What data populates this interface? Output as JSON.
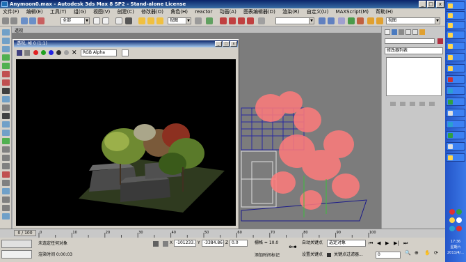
{
  "window": {
    "title": "Anymoon0.max - Autodesk 3ds Max 8 SP2 - Stand-alone License",
    "min_label": "_",
    "max_label": "□",
    "close_label": "x"
  },
  "menu": [
    "文件(F)",
    "编辑(E)",
    "工具(T)",
    "组(G)",
    "视图(V)",
    "创建(C)",
    "修改器(O)",
    "角色(H)",
    "reactor",
    "动画(A)",
    "图表编辑器(D)",
    "渲染(R)",
    "自定义(U)",
    "MAXScript(M)",
    "帮助(H)"
  ],
  "toolbar": {
    "selection_filter": "全部",
    "reference_coord": "视图"
  },
  "viewport": {
    "label": "透视"
  },
  "render_window": {
    "title": "透视, 帧 0 (1:1)",
    "channel": "RGB Alpha"
  },
  "command_panel": {
    "modifier_list": "修改器列表"
  },
  "time_slider": {
    "label": "0 / 100",
    "frame_input": "0"
  },
  "timeline_ticks": [
    "0",
    "10",
    "20",
    "30",
    "40",
    "50",
    "60",
    "70",
    "80",
    "90",
    "100"
  ],
  "status": {
    "prompt": "未选定任何对象",
    "render_time": "渲染时间  0:00:03",
    "x_value": "-101233.",
    "y_value": "-3384.86",
    "z_value": "0.0",
    "grid": "栅格 = 10.0",
    "add_time_tag": "添加时间标记",
    "auto_key": "自动关键点",
    "set_key": "设置关键点",
    "selected_object": "选定对象",
    "key_filters": "关键点过滤器...",
    "current_frame": "0"
  },
  "taskbar": {
    "time": "17:36",
    "weekday": "星期六",
    "date": "2011/4/..."
  },
  "colors": {
    "title_bar": "#0a246a",
    "viewport_bg": "#7c7c7c",
    "render_bg": "#000000",
    "taskbar": "#2455c8"
  }
}
